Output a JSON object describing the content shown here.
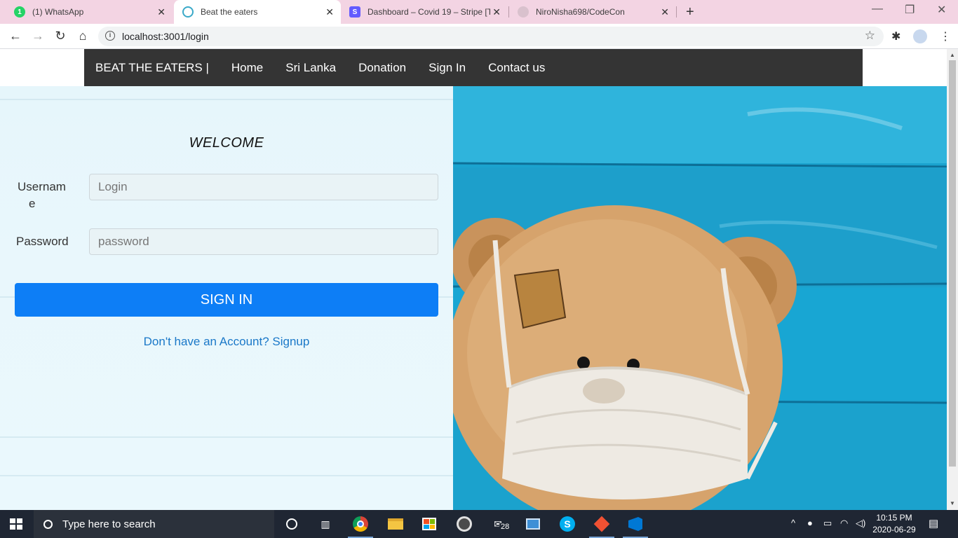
{
  "browser": {
    "tabs": [
      {
        "title": "(1) WhatsApp",
        "favicon": "whatsapp-icon",
        "badge": "1"
      },
      {
        "title": "Beat the eaters",
        "favicon": "react-icon"
      },
      {
        "title": "Dashboard – Covid 19 – Stripe [Te",
        "favicon": "stripe-icon",
        "badge": "S"
      },
      {
        "title": "NiroNisha698/CodeCon",
        "favicon": "github-icon"
      }
    ],
    "url": "localhost:3001/login"
  },
  "navbar": {
    "brand": "BEAT THE EATERS |",
    "links": [
      "Home",
      "Sri Lanka",
      "Donation",
      "Sign In",
      "Contact us"
    ]
  },
  "login": {
    "heading": "WELCOME",
    "username_label_line1": "Usernam",
    "username_label_line2": "e",
    "username_placeholder": "Login",
    "password_label": "Password",
    "password_placeholder": "password",
    "submit_label": "SIGN IN",
    "signup_link": "Don't have an Account? Signup"
  },
  "hero": {
    "description": "teddy-bear-with-face-mask-on-blue-wood"
  },
  "taskbar": {
    "search_placeholder": "Type here to search",
    "mail_badge": "28",
    "time": "10:15 PM",
    "date": "2020-06-29"
  },
  "colors": {
    "navbar_bg": "#343434",
    "button_bg": "#0d7ef6",
    "link": "#1a78c8",
    "tabstrip": "#f3d4e3"
  }
}
